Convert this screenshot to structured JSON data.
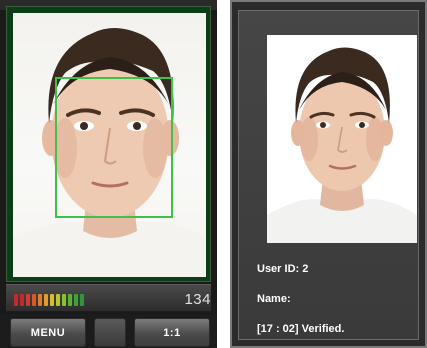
{
  "left_device": {
    "meter": {
      "value": "134",
      "segment_colors": [
        "#c8282a",
        "#c8282a",
        "#d23c28",
        "#d9582a",
        "#de7a2a",
        "#e19d2c",
        "#d8bc2c",
        "#b8c82c",
        "#86c22e",
        "#58b431",
        "#3aa434",
        "#2f9836"
      ]
    },
    "softkeys": {
      "menu_label": "MENU",
      "mode_label": "1:1"
    }
  },
  "right_device": {
    "user_id": "User ID: 2",
    "name": "Name:",
    "status": "[17 : 02] Verified."
  },
  "colors": {
    "face_box": "#3ec04a",
    "camera_frame": "#0d3d17"
  }
}
